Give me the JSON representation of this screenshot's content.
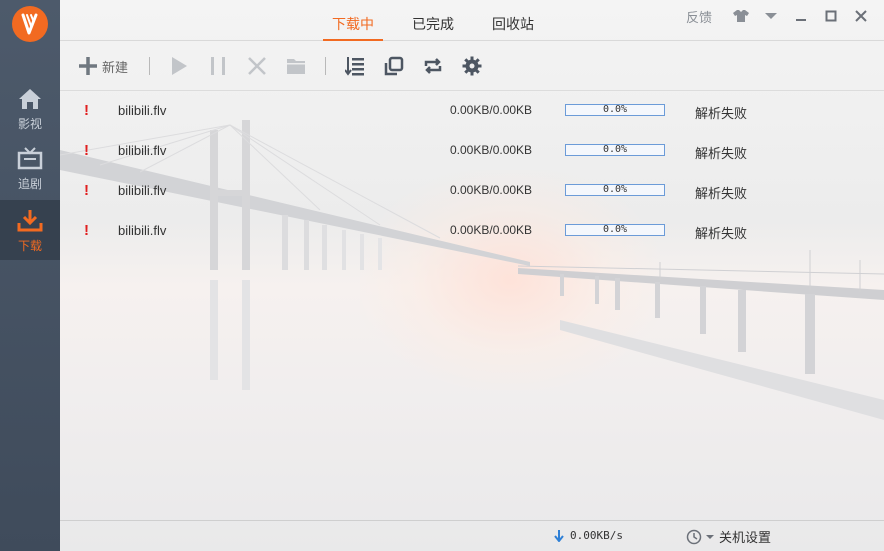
{
  "app": {
    "logo": "app-logo-icon"
  },
  "sidebar": {
    "items": [
      {
        "label": "影视",
        "icon": "home-icon"
      },
      {
        "label": "追剧",
        "icon": "tv-icon"
      },
      {
        "label": "下载",
        "icon": "download-icon",
        "active": true
      }
    ]
  },
  "tabs": [
    {
      "label": "下载中",
      "active": true
    },
    {
      "label": "已完成"
    },
    {
      "label": "回收站"
    }
  ],
  "window": {
    "feedback": "反馈",
    "buttons": [
      "shirt-icon",
      "dropdown-icon",
      "minimize-icon",
      "maximize-icon",
      "close-icon"
    ]
  },
  "toolbar": {
    "new_label": "新建",
    "icons": [
      "plus-icon",
      "play-icon",
      "pause-icon",
      "delete-icon",
      "folder-icon",
      "list-icon",
      "copy-icon",
      "repeat-icon",
      "settings-icon"
    ]
  },
  "downloads": [
    {
      "name": "bilibili.flv",
      "size": "0.00KB/0.00KB",
      "progress": "0.0%",
      "status": "解析失败"
    },
    {
      "name": "bilibili.flv",
      "size": "0.00KB/0.00KB",
      "progress": "0.0%",
      "status": "解析失败"
    },
    {
      "name": "bilibili.flv",
      "size": "0.00KB/0.00KB",
      "progress": "0.0%",
      "status": "解析失败"
    },
    {
      "name": "bilibili.flv",
      "size": "0.00KB/0.00KB",
      "progress": "0.0%",
      "status": "解析失败"
    }
  ],
  "statusbar": {
    "speed": "0.00KB/s",
    "shutdown_label": "关机设置"
  },
  "colors": {
    "accent": "#f26a21",
    "sidebar": "#46525f",
    "error": "#e02020",
    "progress": "#6b9bd8"
  }
}
